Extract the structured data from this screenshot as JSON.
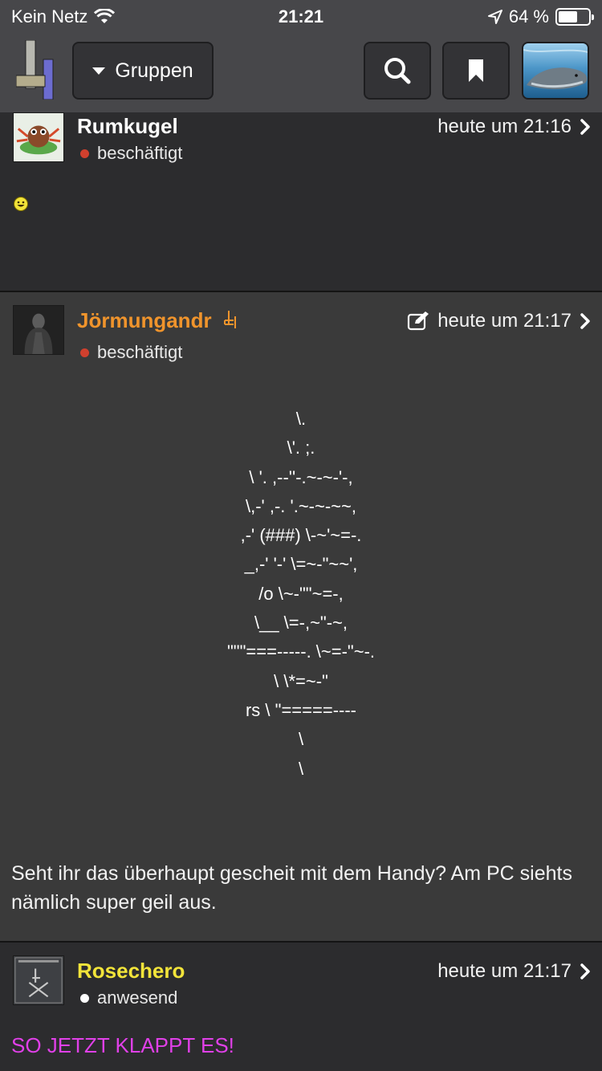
{
  "statusbar": {
    "carrier": "Kein Netz",
    "time": "21:21",
    "battery": "64 %",
    "battery_level": 0.64
  },
  "nav": {
    "groups_label": "Gruppen"
  },
  "posts": [
    {
      "username": "Rumkugel",
      "username_color": "#ffffff",
      "status": "beschäftigt",
      "status_color": "#d0402e",
      "time": "heute um 21:16"
    },
    {
      "username": "Jörmungandr",
      "username_color": "#f0942c",
      "status": "beschäftigt",
      "status_color": "#d0402e",
      "time": "heute um 21:17",
      "ascii_lines": [
        "\\.",
        "\\'. ;.",
        "\\ '. ,--''-.~-~-'-,",
        "\\,-' ,-. '.~-~-~~,",
        ",-' (###) \\-~'~=-.",
        "_,-' '-' \\=~-\"~~',",
        "/o \\~-\"\"~=-,",
        "\\__ \\=-,~\"-~,",
        "\"\"\"===-----. \\~=-\"~-.",
        "\\ \\*=~-\"",
        "rs \\ \"=====----",
        "\\",
        "\\"
      ],
      "text": "Seht ihr das überhaupt gescheit mit dem Handy? Am PC siehts nämlich super geil aus."
    },
    {
      "username": "Rosechero",
      "username_color": "#f2e43a",
      "status": "anwesend",
      "status_color": "#ffffff",
      "time": "heute um 21:17",
      "text": "SO JETZT KLAPPT ES!",
      "text_color": "#e040e8"
    }
  ]
}
